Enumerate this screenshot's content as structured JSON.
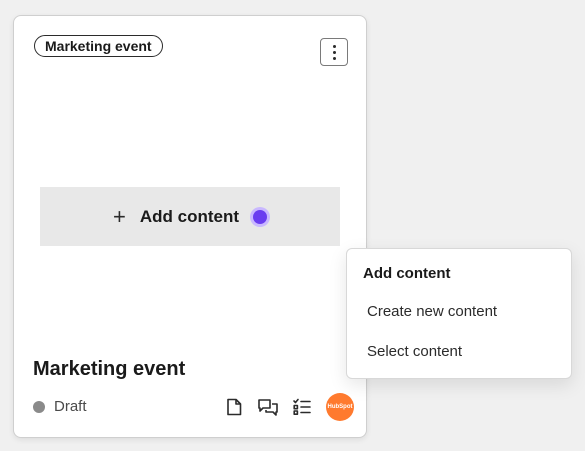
{
  "card": {
    "tag_label": "Marketing event",
    "add_content_label": "Add content",
    "title": "Marketing event",
    "status_label": "Draft",
    "avatar_text": "HubSpot"
  },
  "dropdown": {
    "header": "Add content",
    "items": [
      {
        "label": "Create new content"
      },
      {
        "label": "Select content"
      }
    ]
  },
  "icons": {
    "plus": "plus-icon",
    "more": "kebab-menu-icon",
    "page": "document-icon",
    "comments": "comments-icon",
    "tasks": "checklist-icon"
  },
  "colors": {
    "beacon": "#6a3df0",
    "avatar": "#ff7a2e",
    "status_dot": "#8a8a8a"
  }
}
